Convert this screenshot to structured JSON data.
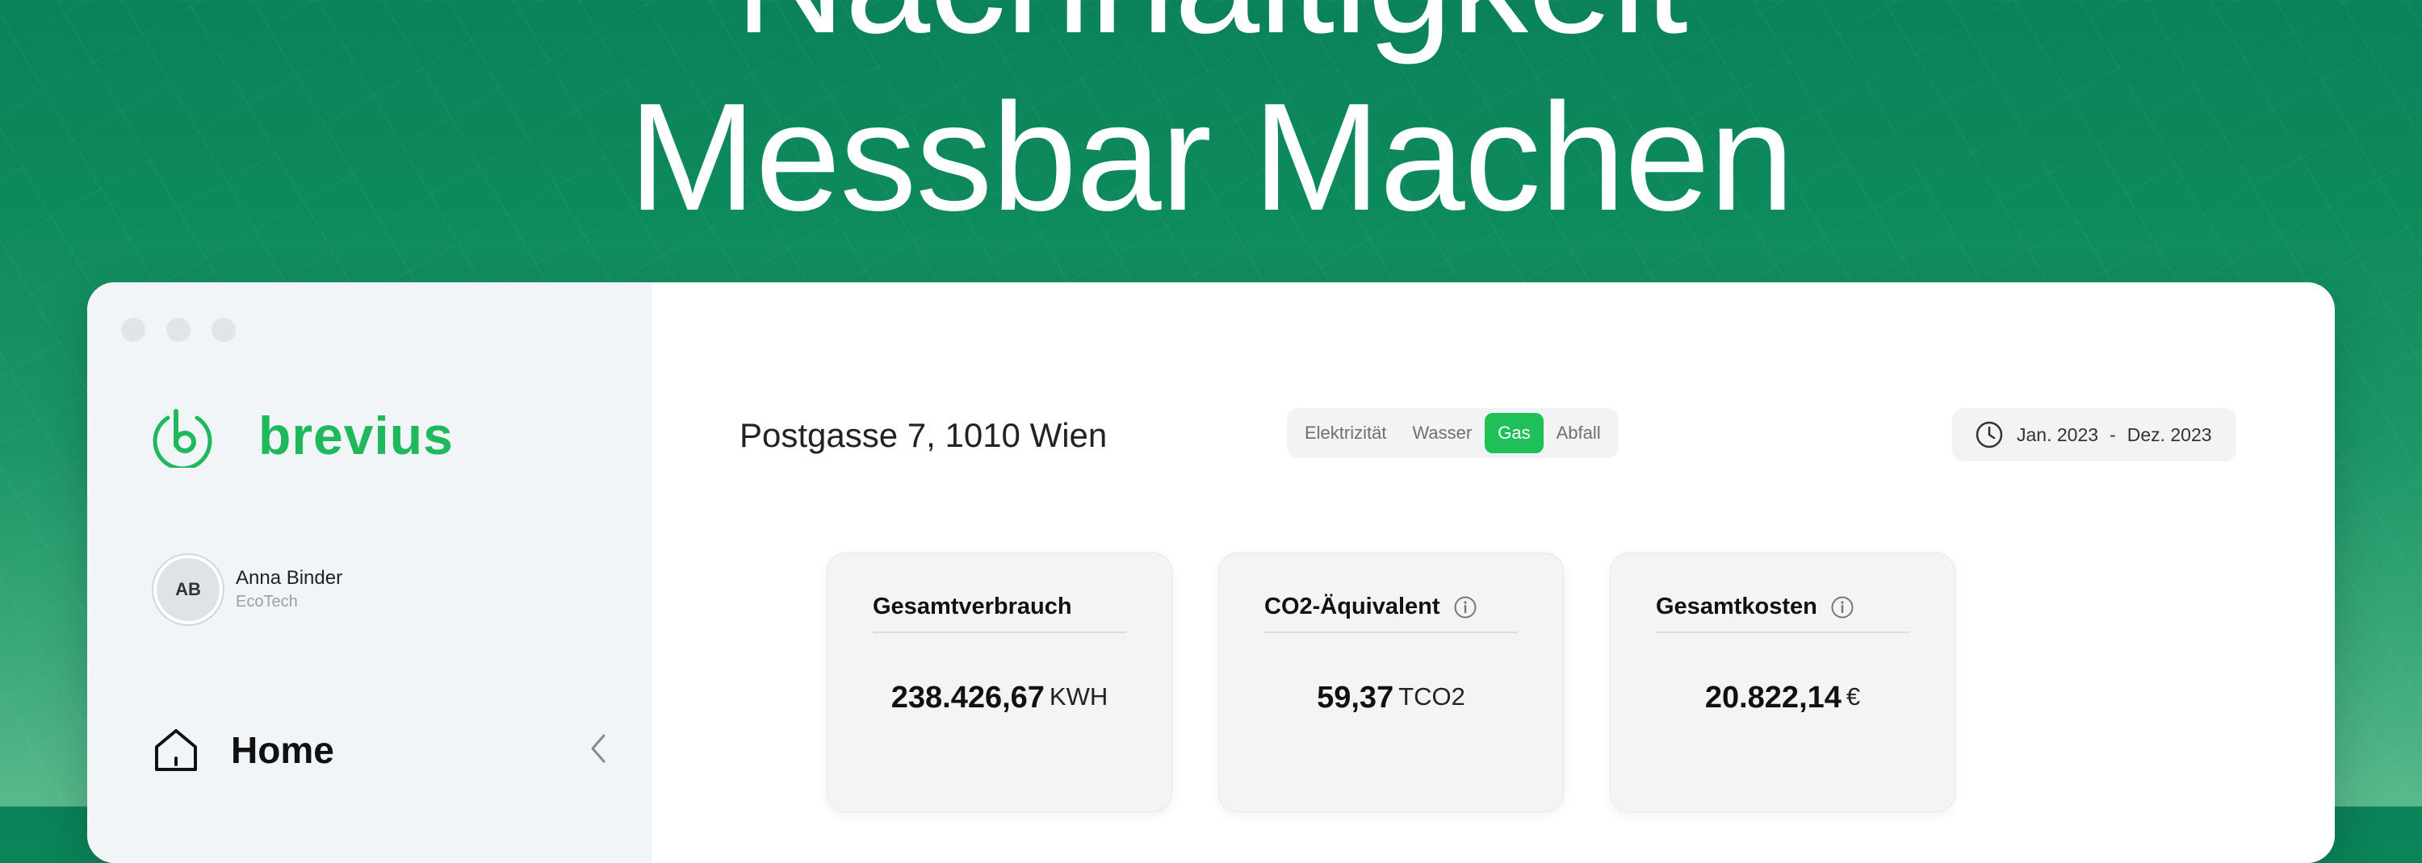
{
  "hero": {
    "line1": "Nachhaltigkeit",
    "line2": "Messbar Machen"
  },
  "brand": {
    "name": "brevius",
    "color": "#1fb85d"
  },
  "user": {
    "initials": "AB",
    "name": "Anna Binder",
    "company": "EcoTech"
  },
  "nav": {
    "home_label": "Home",
    "icons": [
      "home-icon",
      "chevron-left-icon"
    ]
  },
  "header": {
    "address": "Postgasse 7, 1010 Wien",
    "tabs": [
      {
        "label": "Elektrizität",
        "active": false
      },
      {
        "label": "Wasser",
        "active": false
      },
      {
        "label": "Gas",
        "active": true
      },
      {
        "label": "Abfall",
        "active": false
      }
    ],
    "date_range": {
      "start": "Jan. 2023",
      "separator": "-",
      "end": "Dez. 2023"
    }
  },
  "cards": [
    {
      "title": "Gesamtverbrauch",
      "value": "238.426,67",
      "unit": "KWH",
      "info": false
    },
    {
      "title": "CO2-Äquivalent",
      "value": "59,37",
      "unit": "TCO2",
      "info": true
    },
    {
      "title": "Gesamtkosten",
      "value": "20.822,14",
      "unit": "€",
      "info": true
    }
  ],
  "colors": {
    "accent": "#1fc05a",
    "background_green": "#0b8258"
  }
}
